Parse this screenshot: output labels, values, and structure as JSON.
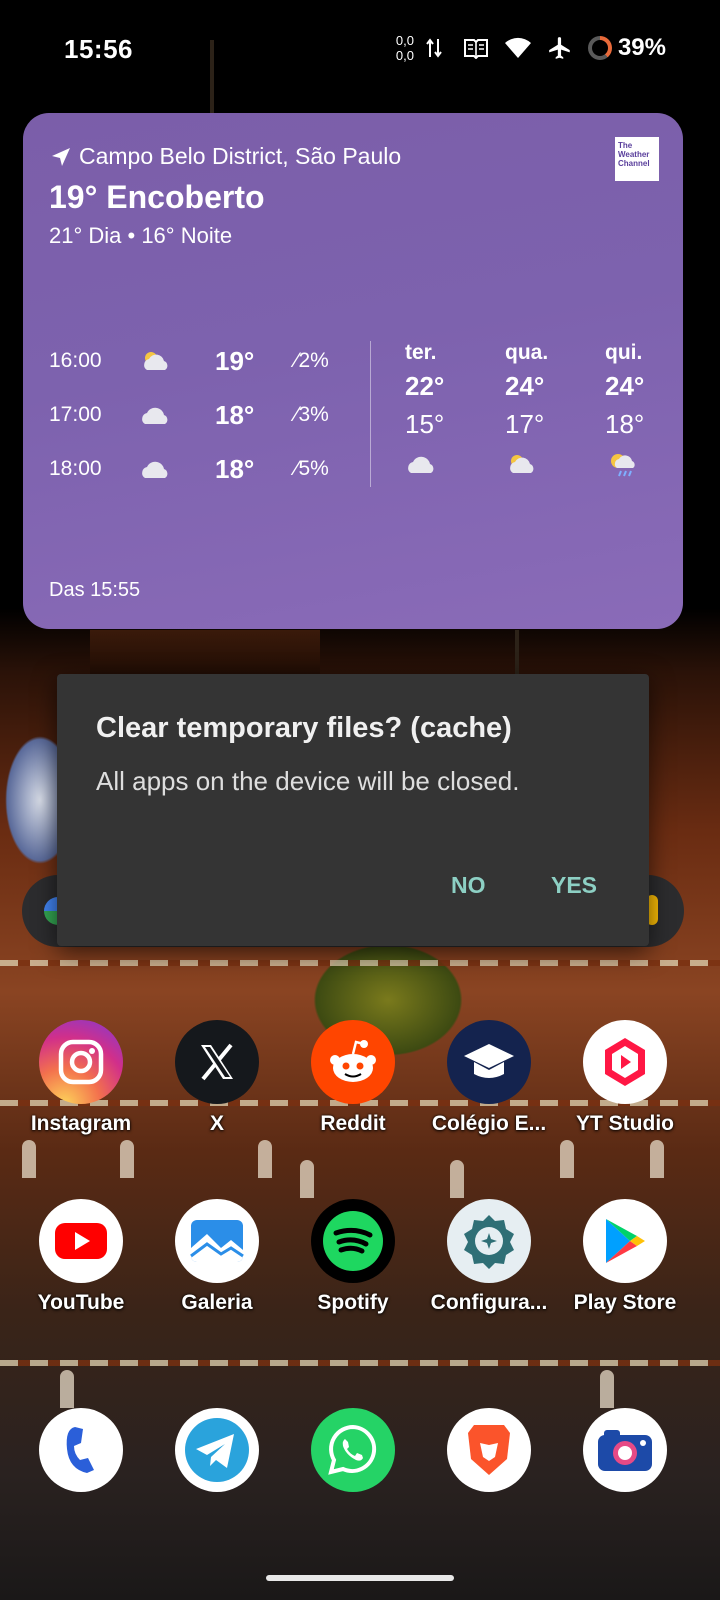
{
  "status_bar": {
    "time": "15:56",
    "net_up": "0,0",
    "net_down": "0,0",
    "icons": [
      "data-arrows-icon",
      "reader-mode-icon",
      "wifi-icon",
      "airplane-mode-icon",
      "battery-ring-icon"
    ],
    "battery_percent": "39%"
  },
  "weather": {
    "location": "Campo Belo District, São Paulo",
    "provider_logo": "The Weather Channel",
    "current": "19° Encoberto",
    "high_low": "21° Dia • 16° Noite",
    "hourly": [
      {
        "time": "16:00",
        "icon": "partly-cloudy-icon",
        "temp": "19°",
        "precip": "⁄2%"
      },
      {
        "time": "17:00",
        "icon": "cloud-icon",
        "temp": "18°",
        "precip": "⁄3%"
      },
      {
        "time": "18:00",
        "icon": "cloud-icon",
        "temp": "18°",
        "precip": "⁄5%"
      }
    ],
    "daily": [
      {
        "day": "ter.",
        "high": "22°",
        "low": "15°",
        "icon": "cloud-icon"
      },
      {
        "day": "qua.",
        "high": "24°",
        "low": "17°",
        "icon": "partly-cloudy-icon"
      },
      {
        "day": "qui.",
        "high": "24°",
        "low": "18°",
        "icon": "sun-rain-icon"
      }
    ],
    "updated": "Das 15:55"
  },
  "dialog": {
    "title": "Clear temporary files? (cache)",
    "message": "All apps on the device will be closed.",
    "no_label": "NO",
    "yes_label": "YES"
  },
  "apps": {
    "row1": [
      {
        "label": "Instagram",
        "icon": "instagram-icon"
      },
      {
        "label": "X",
        "icon": "x-icon"
      },
      {
        "label": "Reddit",
        "icon": "reddit-icon"
      },
      {
        "label": "Colégio E...",
        "icon": "graduation-cap-icon"
      },
      {
        "label": "YT Studio",
        "icon": "yt-studio-icon"
      }
    ],
    "row2": [
      {
        "label": "YouTube",
        "icon": "youtube-icon"
      },
      {
        "label": "Galeria",
        "icon": "gallery-icon"
      },
      {
        "label": "Spotify",
        "icon": "spotify-icon"
      },
      {
        "label": "Configura...",
        "icon": "settings-icon"
      },
      {
        "label": "Play Store",
        "icon": "play-store-icon"
      }
    ],
    "dock": [
      {
        "icon": "phone-icon"
      },
      {
        "icon": "telegram-icon"
      },
      {
        "icon": "whatsapp-icon"
      },
      {
        "icon": "brave-icon"
      },
      {
        "icon": "camera-icon"
      }
    ]
  },
  "colors": {
    "widget_bg": "#7d62ae",
    "dialog_bg": "#343434",
    "dialog_button": "#8dd0c4",
    "battery_ring": "#e86a3a"
  }
}
